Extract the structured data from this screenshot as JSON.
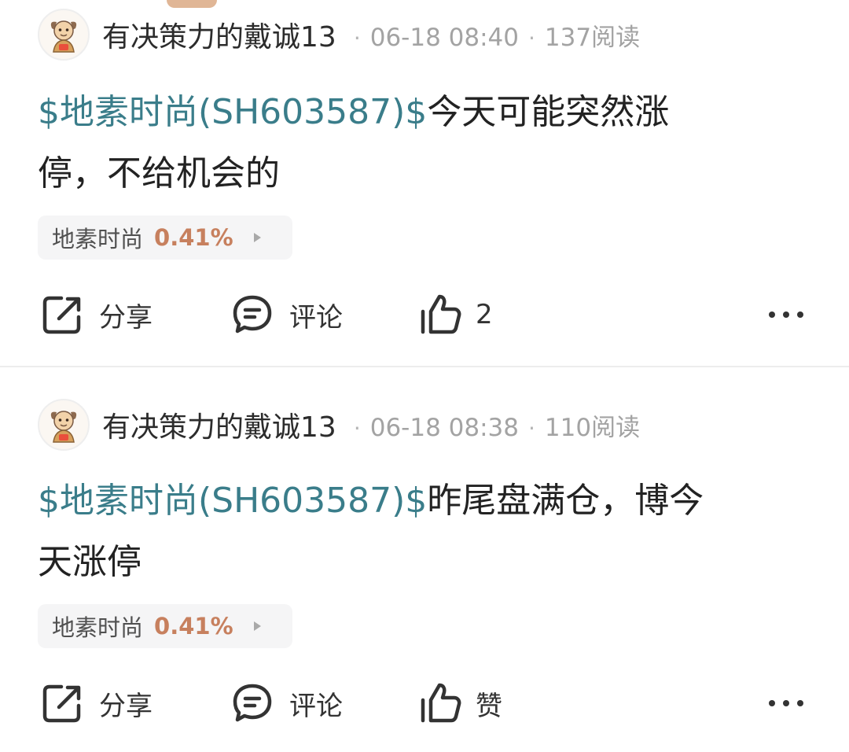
{
  "posts": [
    {
      "author": "有决策力的戴诚13",
      "time": "06-18 08:40",
      "reads": "137阅读",
      "meta_separator": "·",
      "content_cashtag": "$地素时尚(SH603587)$",
      "content_line1_rest": "今天可能突然涨",
      "content_line2": "停，不给机会的",
      "stock": {
        "name": "地素时尚",
        "change": "0.41%"
      },
      "actions": {
        "share": "分享",
        "comment": "评论",
        "like": "2"
      }
    },
    {
      "author": "有决策力的戴诚13",
      "time": "06-18 08:38",
      "reads": "110阅读",
      "meta_separator": "·",
      "content_cashtag": "$地素时尚(SH603587)$",
      "content_line1_rest": "昨尾盘满仓，博今",
      "content_line2": "天涨停",
      "stock": {
        "name": "地素时尚",
        "change": "0.41%"
      },
      "actions": {
        "share": "分享",
        "comment": "评论",
        "like": "赞"
      }
    }
  ],
  "colors": {
    "cashtag": "#3a7d8a",
    "stock_change": "#c7805e",
    "meta": "#a3a3a3",
    "text": "#222222"
  },
  "icons": {
    "avatar": "cartoon-figure-avatar",
    "share": "share-icon",
    "comment": "comment-icon",
    "like": "thumbs-up-icon",
    "more": "more-dots-icon"
  }
}
